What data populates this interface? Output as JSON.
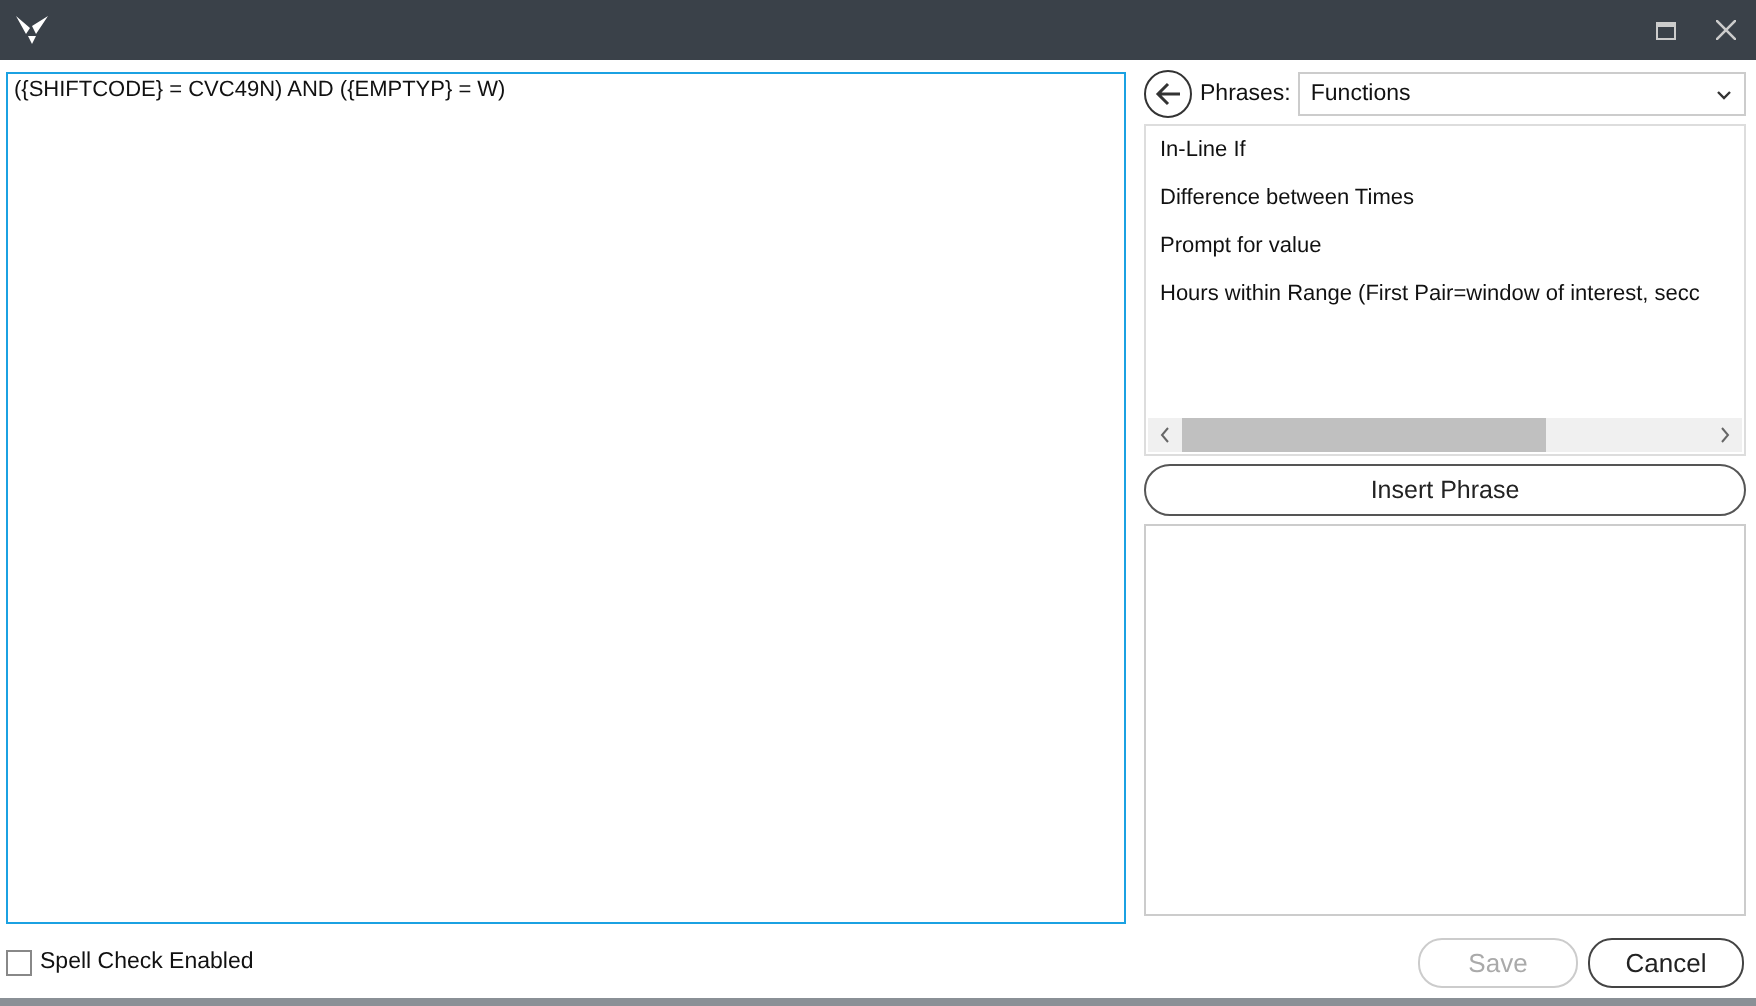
{
  "editor": {
    "value": "({SHIFTCODE} = CVC49N) AND ({EMPTYP} = W)"
  },
  "phrases": {
    "label": "Phrases:",
    "selection": "Functions",
    "items": [
      {
        "label": "In-Line If",
        "selected": false
      },
      {
        "label": "Difference between Times",
        "selected": false
      },
      {
        "label": "Prompt for value",
        "selected": false
      },
      {
        "label": "Hours within Range (First Pair=window of interest, secc",
        "selected": false
      }
    ],
    "insert_button": "Insert Phrase"
  },
  "spell_check": {
    "label": "Spell Check Enabled",
    "checked": false
  },
  "buttons": [
    {
      "label": "Save",
      "disabled": true
    },
    {
      "label": "Cancel",
      "disabled": false
    }
  ]
}
